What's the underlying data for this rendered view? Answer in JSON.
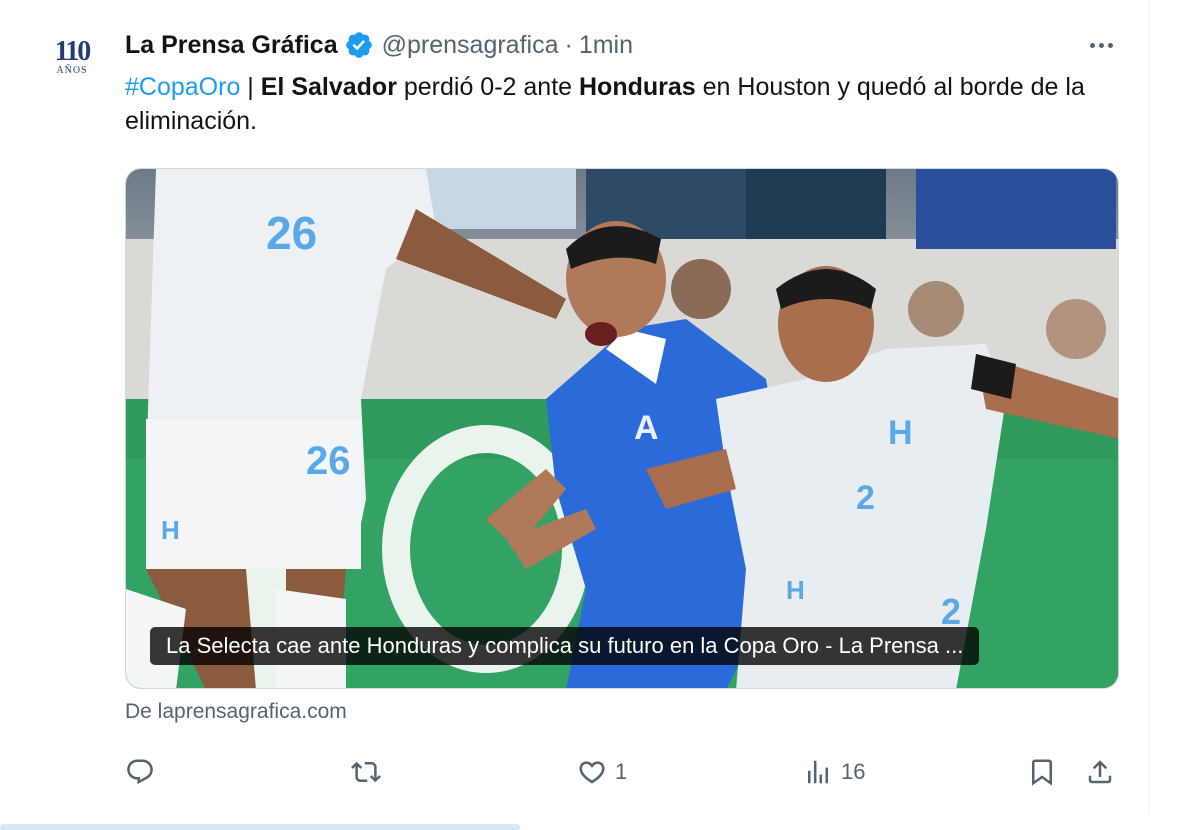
{
  "account": {
    "avatar_number": "110",
    "avatar_subtitle": "AÑOS",
    "name": "La Prensa Gráfica",
    "handle": "@prensagrafica",
    "separator": "·",
    "time": "1min"
  },
  "tweet": {
    "hashtag": "#CopaOro",
    "sep": " | ",
    "team1": "El Salvador",
    "mid1": " perdió 0-2 ante ",
    "team2": "Honduras",
    "rest": " en Houston y quedó al borde de la eliminación."
  },
  "card": {
    "caption": "La Selecta cae ante Honduras y complica su futuro en la Copa Oro - La Prensa ...",
    "source": "De laprensagrafica.com"
  },
  "actions": {
    "reply_count": "",
    "retweet_count": "",
    "like_count": "1",
    "views_count": "16"
  },
  "colors": {
    "accent": "#1d9bf0",
    "secondary_text": "#536471",
    "honduras_kit": "#e8edf2",
    "el_salvador_kit": "#2a6ad9",
    "pitch_board": "#2e9a5c"
  }
}
